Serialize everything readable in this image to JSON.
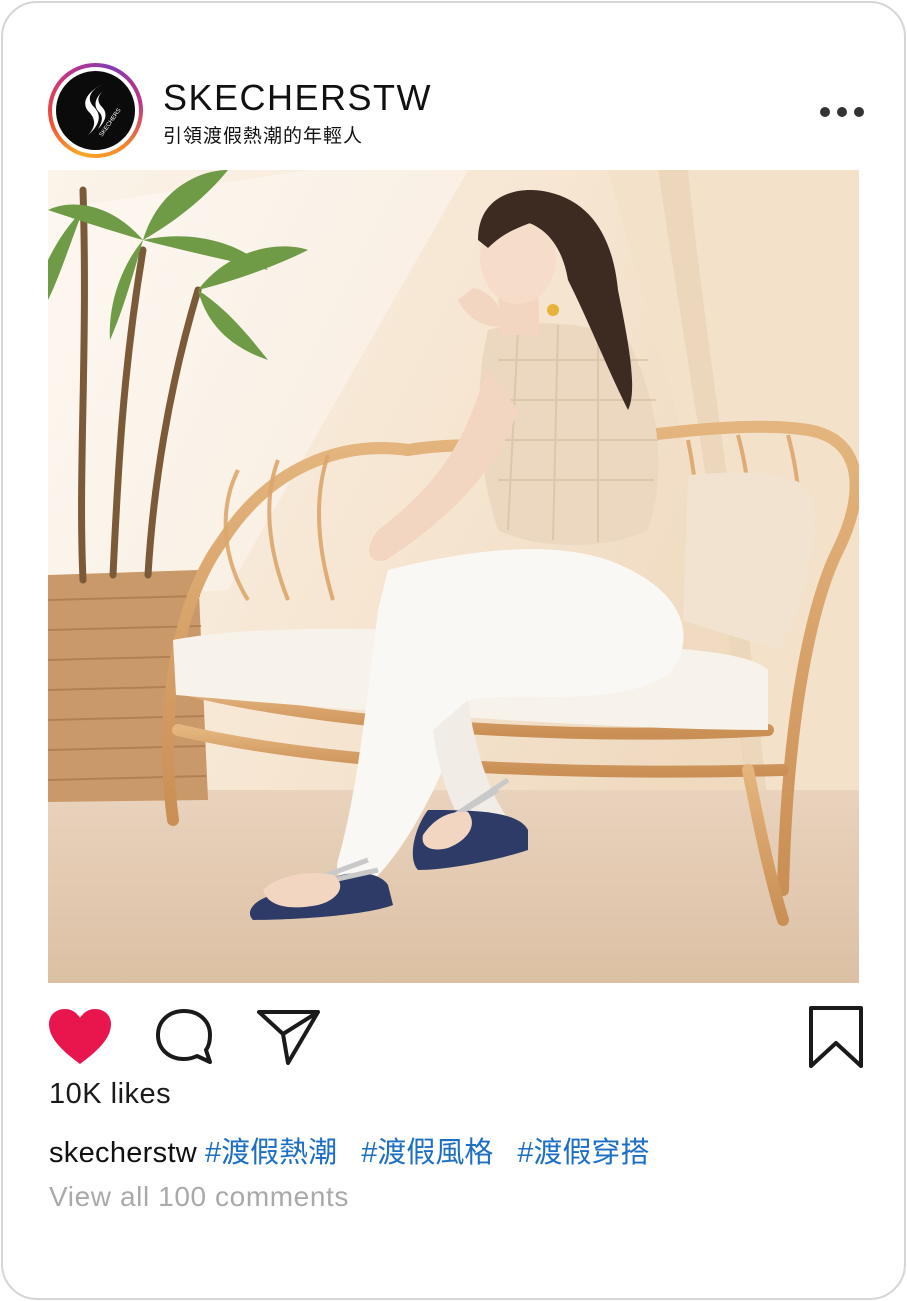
{
  "post": {
    "account_name": "SKECHERSTW",
    "account_tagline": "引領渡假熱潮的年輕人",
    "avatar_text": "SKECHERS",
    "photo_description_icon": "photo-of-woman-on-rattan-sofa",
    "likes_text": "10K likes",
    "caption_user": "skecherstw",
    "hashtags": [
      "#渡假熱潮",
      "#渡假風格",
      "#渡假穿搭"
    ],
    "comments_link": "View all 100 comments"
  },
  "icons": {
    "more": "more-options-icon",
    "like": "heart-icon",
    "comment": "comment-icon",
    "share": "send-icon",
    "save": "bookmark-icon"
  },
  "colors": {
    "like_red": "#e8164d",
    "hashtag_blue": "#1c6fc2",
    "muted_gray": "#a9a9a9"
  }
}
